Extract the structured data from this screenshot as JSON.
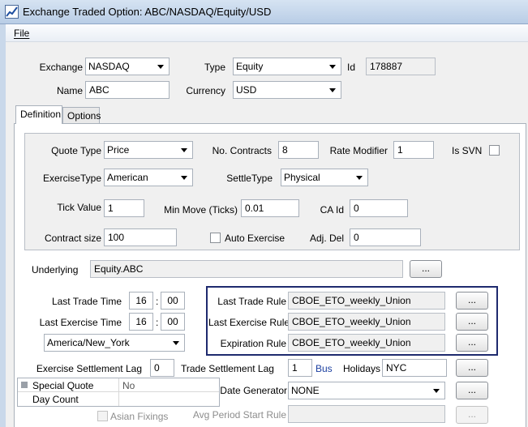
{
  "window": {
    "title": "Exchange Traded Option: ABC/NASDAQ/Equity/USD"
  },
  "menu": {
    "file": "File"
  },
  "header": {
    "exchange_label": "Exchange",
    "exchange_value": "NASDAQ",
    "type_label": "Type",
    "type_value": "Equity",
    "id_label": "Id",
    "id_value": "178887",
    "name_label": "Name",
    "name_value": "ABC",
    "currency_label": "Currency",
    "currency_value": "USD"
  },
  "tabs": [
    {
      "label": "Definition"
    },
    {
      "label": "Options"
    }
  ],
  "definition": {
    "quote_type_label": "Quote Type",
    "quote_type_value": "Price",
    "no_contracts_label": "No. Contracts",
    "no_contracts_value": "8",
    "rate_modifier_label": "Rate Modifier",
    "rate_modifier_value": "1",
    "is_svn_label": "Is SVN",
    "exercise_type_label": "ExerciseType",
    "exercise_type_value": "American",
    "settle_type_label": "SettleType",
    "settle_type_value": "Physical",
    "tick_value_label": "Tick Value",
    "tick_value_value": "1",
    "min_move_label": "Min Move (Ticks)",
    "min_move_value": "0.01",
    "ca_id_label": "CA Id",
    "ca_id_value": "0",
    "contract_size_label": "Contract size",
    "contract_size_value": "100",
    "auto_exercise_label": "Auto Exercise",
    "adj_del_label": "Adj. Del",
    "adj_del_value": "0"
  },
  "underlying": {
    "label": "Underlying",
    "value": "Equity.ABC",
    "button": "..."
  },
  "times": {
    "last_trade_label": "Last Trade Time",
    "last_trade_hh": "16",
    "last_trade_mm": "00",
    "last_exercise_label": "Last Exercise Time",
    "last_exercise_hh": "16",
    "last_exercise_mm": "00",
    "separator": ":",
    "timezone_value": "America/New_York"
  },
  "rules": {
    "last_trade_rule_label": "Last Trade Rule",
    "last_trade_rule_value": "CBOE_ETO_weekly_Union",
    "last_exercise_rule_label": "Last Exercise Rule",
    "last_exercise_rule_value": "CBOE_ETO_weekly_Union",
    "expiration_rule_label": "Expiration Rule",
    "expiration_rule_value": "CBOE_ETO_weekly_Union",
    "button": "..."
  },
  "settlement": {
    "exercise_lag_label": "Exercise Settlement Lag",
    "exercise_lag_value": "0",
    "trade_lag_label": "Trade Settlement Lag",
    "trade_lag_value": "1",
    "bus_label": "Bus",
    "holidays_label": "Holidays",
    "holidays_value": "NYC",
    "button": "..."
  },
  "props": [
    {
      "name": "Special Quote",
      "value": "No"
    },
    {
      "name": "Day Count",
      "value": ""
    }
  ],
  "date_generator": {
    "label": "Date Generator",
    "value": "NONE",
    "button": "..."
  },
  "bottom": {
    "asian_fixings_label": "Asian Fixings",
    "avg_period_label": "Avg Period Start Rule",
    "button": "..."
  },
  "colors": {
    "rule_box_border": "#1e2a6e",
    "bus_text": "#1b3fa0"
  }
}
